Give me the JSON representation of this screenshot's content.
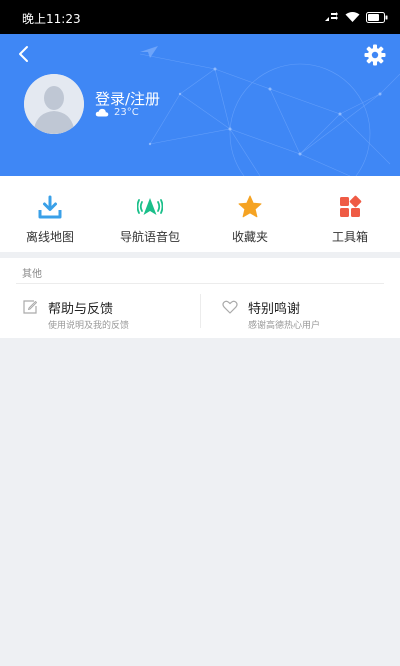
{
  "status_bar": {
    "time": "晚上11:23",
    "icons": [
      "data-signal-icon",
      "wifi-icon",
      "battery-icon"
    ]
  },
  "header": {
    "background_color": "#3f87f5",
    "login_label": "登录/注册",
    "weather": {
      "icon": "cloud-icon",
      "temperature": "23°C"
    }
  },
  "tools": [
    {
      "label": "离线地图",
      "icon": "download-icon",
      "color": "#3aa0e8"
    },
    {
      "label": "导航语音包",
      "icon": "voice-navigation-icon",
      "color": "#1bbf8a"
    },
    {
      "label": "收藏夹",
      "icon": "star-icon",
      "color": "#f5a323"
    },
    {
      "label": "工具箱",
      "icon": "toolbox-icon",
      "color": "#ef5b45"
    }
  ],
  "other_section": {
    "title": "其他",
    "items": [
      {
        "title": "帮助与反馈",
        "subtitle": "使用说明及我的反馈",
        "icon": "edit-icon"
      },
      {
        "title": "特别鸣谢",
        "subtitle": "感谢高德热心用户",
        "icon": "heart-icon"
      }
    ]
  }
}
